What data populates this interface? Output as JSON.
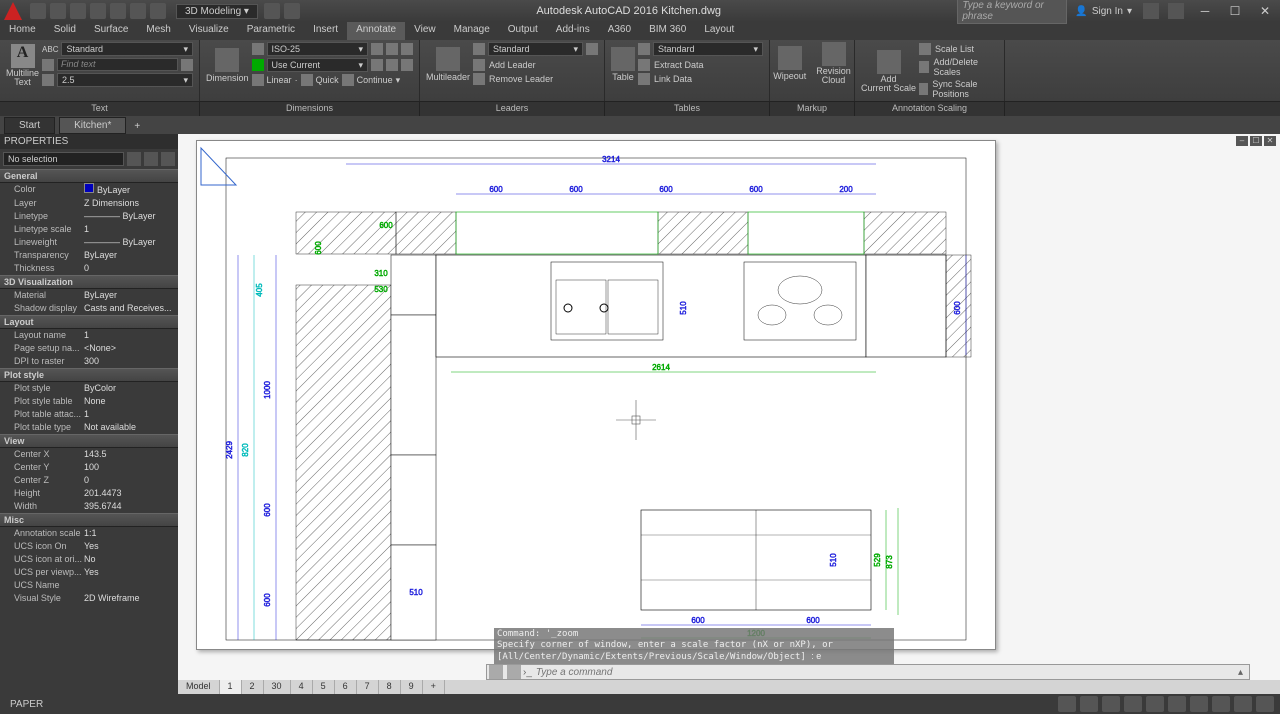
{
  "title": "Autodesk AutoCAD 2016   Kitchen.dwg",
  "workspace": "3D Modeling",
  "search_placeholder": "Type a keyword or phrase",
  "signin": "Sign In",
  "menus": [
    "Home",
    "Solid",
    "Surface",
    "Mesh",
    "Visualize",
    "Parametric",
    "Insert",
    "Annotate",
    "View",
    "Manage",
    "Output",
    "Add-ins",
    "A360",
    "BIM 360",
    "Layout"
  ],
  "active_menu": "Annotate",
  "ribbon": {
    "text": {
      "style": "Standard",
      "find": "Find text",
      "height": "2.5",
      "big": "Multiline\nText",
      "footer": "Text"
    },
    "dim": {
      "style": "ISO-25",
      "layer": "Use Current",
      "linear": "Linear",
      "quick": "Quick",
      "continue": "Continue",
      "big": "Dimension",
      "footer": "Dimensions"
    },
    "lead": {
      "style": "Standard",
      "add": "Add Leader",
      "rem": "Remove Leader",
      "big": "Multileader",
      "footer": "Leaders"
    },
    "tbl": {
      "style": "Standard",
      "ext": "Extract Data",
      "link": "Link Data",
      "big": "Table",
      "footer": "Tables"
    },
    "mk": {
      "wipe": "Wipeout",
      "cloud": "Revision\nCloud",
      "footer": "Markup"
    },
    "scl": {
      "add": "Add\nCurrent Scale",
      "list": "Scale List",
      "ad": "Add/Delete Scales",
      "sync": "Sync Scale Positions",
      "footer": "Annotation Scaling"
    }
  },
  "doctabs": {
    "start": "Start",
    "file": "Kitchen*"
  },
  "props": {
    "title": "PROPERTIES",
    "sel": "No selection",
    "cats": [
      {
        "name": "General",
        "rows": [
          [
            "Color",
            "ByLayer",
            true
          ],
          [
            "Layer",
            "Z Dimensions"
          ],
          [
            "Linetype",
            "———— ByLayer"
          ],
          [
            "Linetype scale",
            "1"
          ],
          [
            "Lineweight",
            "———— ByLayer"
          ],
          [
            "Transparency",
            "ByLayer"
          ],
          [
            "Thickness",
            "0"
          ]
        ]
      },
      {
        "name": "3D Visualization",
        "rows": [
          [
            "Material",
            "ByLayer"
          ],
          [
            "Shadow display",
            "Casts and Receives..."
          ]
        ]
      },
      {
        "name": "Layout",
        "rows": [
          [
            "Layout name",
            "1"
          ],
          [
            "Page setup na...",
            "<None>"
          ],
          [
            "DPI to raster",
            "300"
          ]
        ]
      },
      {
        "name": "Plot style",
        "rows": [
          [
            "Plot style",
            "ByColor"
          ],
          [
            "Plot style table",
            "None"
          ],
          [
            "Plot table attac...",
            "1"
          ],
          [
            "Plot table type",
            "Not available"
          ]
        ]
      },
      {
        "name": "View",
        "rows": [
          [
            "Center X",
            "143.5"
          ],
          [
            "Center Y",
            "100"
          ],
          [
            "Center Z",
            "0"
          ],
          [
            "Height",
            "201.4473"
          ],
          [
            "Width",
            "395.6744"
          ]
        ]
      },
      {
        "name": "Misc",
        "rows": [
          [
            "Annotation scale",
            "1:1"
          ],
          [
            "UCS icon On",
            "Yes"
          ],
          [
            "UCS icon at ori...",
            "No"
          ],
          [
            "UCS per viewp...",
            "Yes"
          ],
          [
            "UCS Name",
            ""
          ],
          [
            "Visual Style",
            "2D Wireframe"
          ]
        ]
      }
    ]
  },
  "cmd": {
    "hist": [
      "Command: '_zoom",
      "Specify corner of window, enter a scale factor (nX or nXP), or",
      "[All/Center/Dynamic/Extents/Previous/Scale/Window/Object] <real time>:  e"
    ],
    "placeholder": "Type a command"
  },
  "layout_tabs": [
    "Model",
    "1",
    "2",
    "30",
    "4",
    "5",
    "6",
    "7",
    "8",
    "9",
    "+"
  ],
  "drawing": {
    "top_dim": "3214",
    "upper_dims": [
      "600",
      "600",
      "600",
      "600",
      "200"
    ],
    "upper_green": "600",
    "wall1": "310",
    "wall1b": "530",
    "left_h": "2429",
    "left_405": "405",
    "left_820": "820",
    "left_1000": "1000",
    "left_600a": "600",
    "left_600b": "600",
    "left_510": "510",
    "mid_510": "510",
    "right_h": "600",
    "mid_600": "600",
    "green_span": "2614",
    "island": {
      "w": "1200",
      "c1": "600",
      "c2": "600",
      "h1": "529",
      "h2": "873",
      "h3": "510"
    }
  },
  "status_paper": "PAPER"
}
